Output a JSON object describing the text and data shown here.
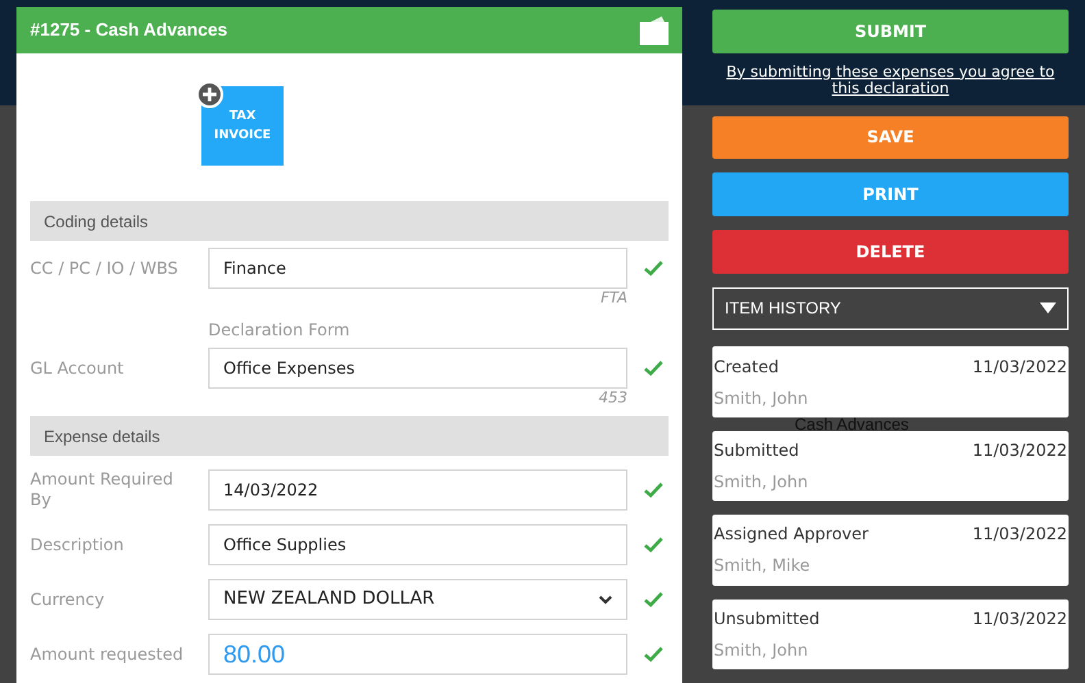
{
  "background": {
    "fragments": [
      "Cash Advances"
    ]
  },
  "dialog": {
    "title": "#1275 - Cash Advances",
    "attachment": {
      "label_lines": [
        "TAX",
        "INVOICE"
      ]
    },
    "sections": [
      {
        "title": "Coding details",
        "fields": [
          {
            "label": "CC / PC / IO / WBS",
            "value": "Finance",
            "kind": "text",
            "hint": "FTA",
            "valid": true
          },
          {
            "label": "GL Account",
            "note": "Declaration Form",
            "value": "Office Expenses",
            "kind": "text",
            "hint": "453",
            "valid": true
          }
        ]
      },
      {
        "title": "Expense details",
        "fields": [
          {
            "label": "Amount Required By",
            "value": "14/03/2022",
            "kind": "text",
            "valid": true
          },
          {
            "label": "Description",
            "value": "Office Supplies",
            "kind": "text",
            "valid": true
          },
          {
            "label": "Currency",
            "value": "NEW ZEALAND DOLLAR",
            "kind": "select",
            "valid": true
          },
          {
            "label": "Amount requested",
            "value": "80.00",
            "kind": "amount",
            "valid": true
          }
        ]
      }
    ]
  },
  "actions": {
    "buttons": [
      {
        "label": "SUBMIT",
        "kind": "submit"
      },
      {
        "label": "SAVE",
        "kind": "save"
      },
      {
        "label": "PRINT",
        "kind": "print"
      },
      {
        "label": "DELETE",
        "kind": "delete"
      }
    ],
    "declaration_link": "By submitting these expenses you agree to this declaration",
    "history": {
      "title": "ITEM HISTORY",
      "expanded": true,
      "entries": [
        {
          "event": "Created",
          "date": "11/03/2022",
          "user": "Smith, John"
        },
        {
          "event": "Submitted",
          "date": "11/03/2022",
          "user": "Smith, John"
        },
        {
          "event": "Assigned Approver",
          "date": "11/03/2022",
          "user": "Smith, Mike"
        },
        {
          "event": "Unsubmitted",
          "date": "11/03/2022",
          "user": "Smith, John"
        }
      ]
    }
  }
}
